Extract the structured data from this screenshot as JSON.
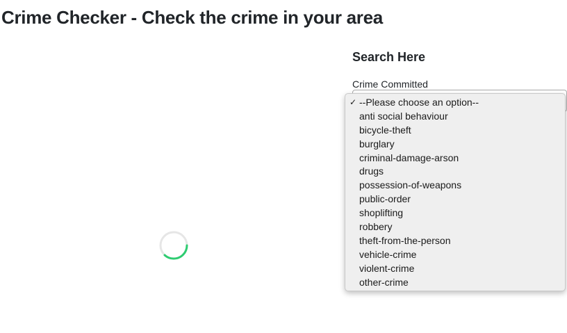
{
  "page": {
    "title": "Crime Checker - Check the crime in your area"
  },
  "search": {
    "heading": "Search Here",
    "crime_label": "Crime Committed",
    "selected_value": "--Please choose an option--",
    "options": [
      "--Please choose an option--",
      "anti social behaviour",
      "bicycle-theft",
      "burglary",
      "criminal-damage-arson",
      "drugs",
      "possession-of-weapons",
      "public-order",
      "shoplifting",
      "robbery",
      "theft-from-the-person",
      "vehicle-crime",
      "violent-crime",
      "other-crime"
    ]
  },
  "icons": {
    "spinner": "loading-spinner-icon",
    "check": "checkmark-icon",
    "select_arrow": "chevron-down-icon"
  },
  "colors": {
    "spinner_accent": "#2ecc71",
    "spinner_track": "#e6e6e6",
    "dropdown_bg": "#efefef"
  }
}
